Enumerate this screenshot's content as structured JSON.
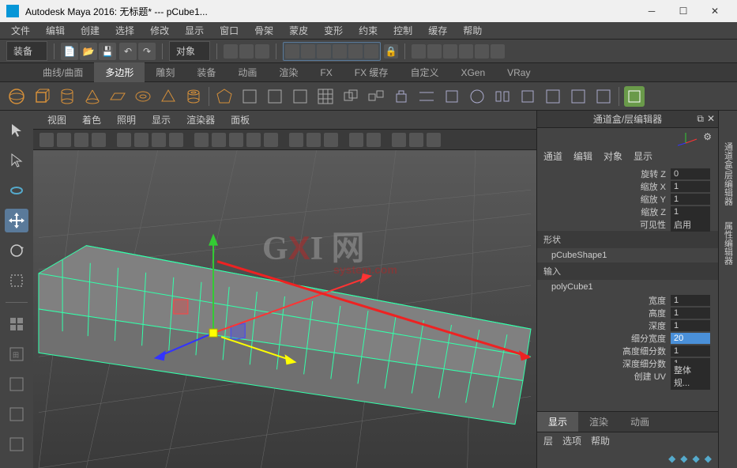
{
  "window": {
    "title": "Autodesk Maya 2016: 无标题* ---   pCube1..."
  },
  "menu": [
    "文件",
    "编辑",
    "创建",
    "选择",
    "修改",
    "显示",
    "窗口",
    "骨架",
    "蒙皮",
    "变形",
    "约束",
    "控制",
    "缓存",
    "帮助"
  ],
  "workspace_dropdown": "装备",
  "object_dropdown": "对象",
  "shelf_tabs": [
    "曲线/曲面",
    "多边形",
    "雕刻",
    "装备",
    "动画",
    "渲染",
    "FX",
    "FX 缓存",
    "自定义",
    "XGen",
    "VRay"
  ],
  "active_shelf_tab": "多边形",
  "viewport_menu": [
    "视图",
    "着色",
    "照明",
    "显示",
    "渲染器",
    "面板"
  ],
  "panel": {
    "title": "通道盒/层编辑器",
    "menu": [
      "通道",
      "编辑",
      "对象",
      "显示"
    ],
    "channels": [
      {
        "label": "旋转 Z",
        "value": "0"
      },
      {
        "label": "缩放 X",
        "value": "1"
      },
      {
        "label": "缩放 Y",
        "value": "1"
      },
      {
        "label": "缩放 Z",
        "value": "1"
      },
      {
        "label": "可见性",
        "value": "启用"
      }
    ],
    "shape_section": "形状",
    "shape_name": "pCubeShape1",
    "input_section": "输入",
    "input_name": "polyCube1",
    "attrs": [
      {
        "label": "宽度",
        "value": "1"
      },
      {
        "label": "高度",
        "value": "1"
      },
      {
        "label": "深度",
        "value": "1"
      },
      {
        "label": "细分宽度",
        "value": "20",
        "selected": true
      },
      {
        "label": "高度细分数",
        "value": "1"
      },
      {
        "label": "深度细分数",
        "value": "1"
      },
      {
        "label": "创建 UV",
        "value": "整体规..."
      }
    ],
    "bottom_tabs": [
      "显示",
      "渲染",
      "动画"
    ],
    "layer_menu": [
      "层",
      "选项",
      "帮助"
    ]
  },
  "right_vtabs": [
    "通道盒/层编辑器",
    "属性编辑器"
  ]
}
